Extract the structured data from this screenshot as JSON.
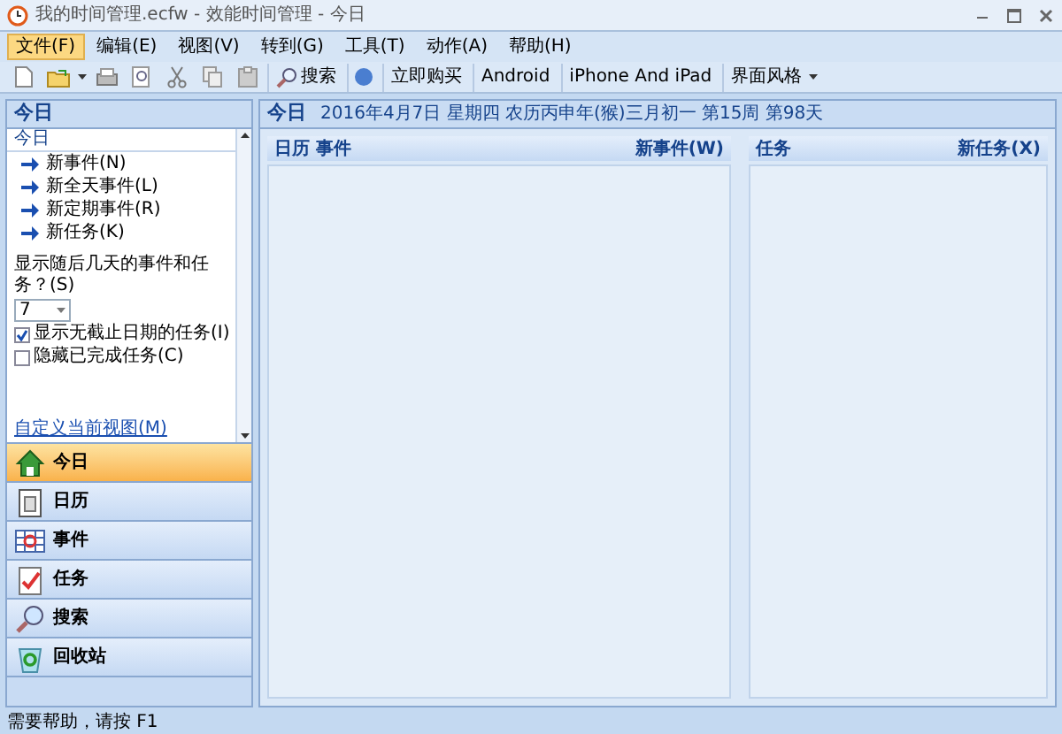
{
  "window": {
    "title": "我的时间管理.ecfw - 效能时间管理 - 今日"
  },
  "menu": [
    {
      "label": "文件(F)",
      "selected": true
    },
    {
      "label": "编辑(E)",
      "selected": false
    },
    {
      "label": "视图(V)",
      "selected": false
    },
    {
      "label": "转到(G)",
      "selected": false
    },
    {
      "label": "工具(T)",
      "selected": false
    },
    {
      "label": "动作(A)",
      "selected": false
    },
    {
      "label": "帮助(H)",
      "selected": false
    }
  ],
  "toolbar": {
    "search": "搜索",
    "buttons": [
      "立即购买",
      "Android",
      "iPhone And iPad"
    ],
    "style_menu": "界面风格"
  },
  "sidebar": {
    "title": "今日",
    "section": "今日",
    "actions": [
      "新事件(N)",
      "新全天事件(L)",
      "新定期事件(R)",
      "新任务(K)"
    ],
    "days_label": "显示随后几天的事件和任务？(S)",
    "days_value": "7",
    "options": [
      {
        "label": "显示无截止日期的任务(I)",
        "checked": true
      },
      {
        "label": "隐藏已完成任务(C)",
        "checked": false
      }
    ],
    "link": "自定义当前视图(M)",
    "nav": [
      {
        "label": "今日",
        "kind": "home",
        "selected": true
      },
      {
        "label": "日历",
        "kind": "calendar",
        "selected": false
      },
      {
        "label": "事件",
        "kind": "events",
        "selected": false
      },
      {
        "label": "任务",
        "kind": "tasks",
        "selected": false
      },
      {
        "label": "搜索",
        "kind": "search",
        "selected": false
      },
      {
        "label": "回收站",
        "kind": "recycle",
        "selected": false
      }
    ]
  },
  "main": {
    "title": "今日",
    "date": "2016年4月7日 星期四 农历丙申年(猴)三月初一 第15周 第98天",
    "events_panel": {
      "title": "日历 事件",
      "action": "新事件(W)"
    },
    "tasks_panel": {
      "title": "任务",
      "action": "新任务(X)"
    }
  },
  "status_bar": "需要帮助，请按 F1"
}
